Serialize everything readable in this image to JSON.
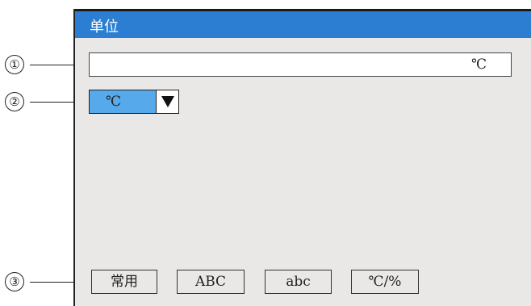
{
  "callouts": [
    "①",
    "②",
    "③"
  ],
  "window": {
    "title": "单位",
    "title_bar_color": "#2b7ed1"
  },
  "unit_input": {
    "value": "℃"
  },
  "unit_select": {
    "selected": "℃",
    "highlight_color": "#56a9ea",
    "arrow_icon": "triangle-down-icon"
  },
  "char_buttons": [
    "常用",
    "ABC",
    "abc",
    "℃/%"
  ]
}
